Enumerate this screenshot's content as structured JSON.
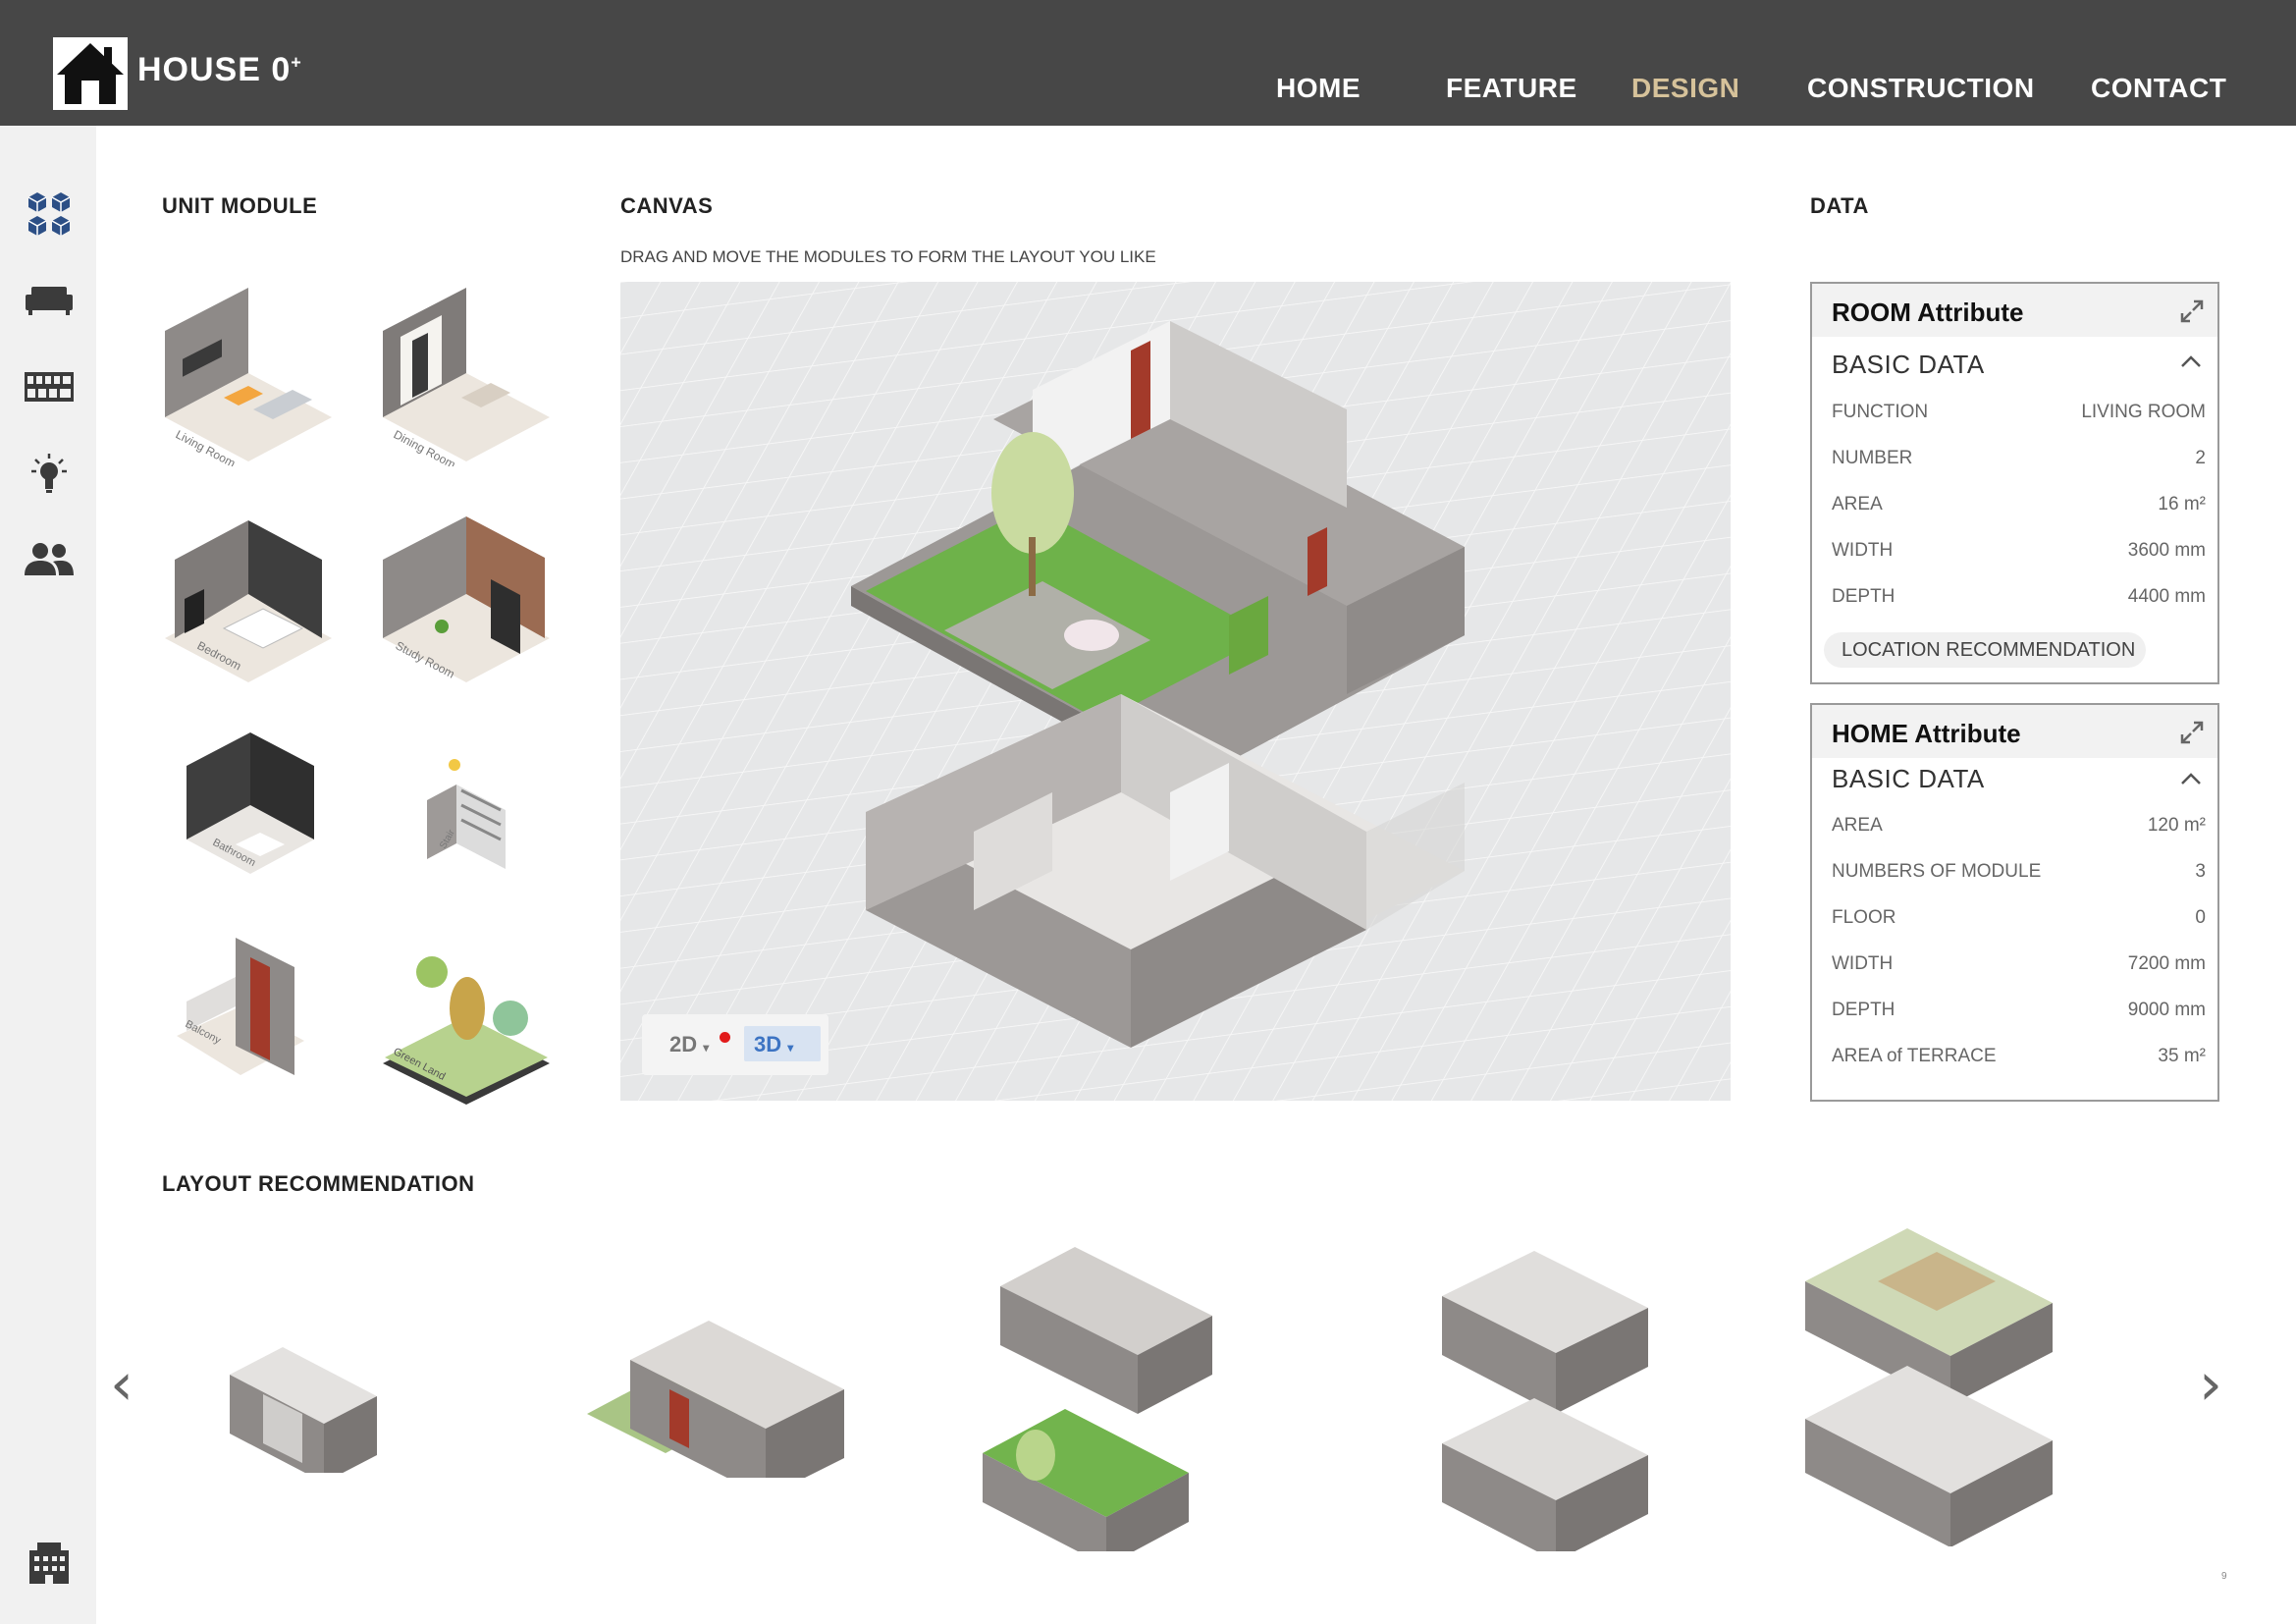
{
  "header": {
    "brand": "HOUSE 0",
    "brand_sup": "+",
    "nav": [
      {
        "label": "HOME",
        "active": false
      },
      {
        "label": "FEATURE",
        "active": false
      },
      {
        "label": "DESIGN",
        "active": true
      },
      {
        "label": "CONSTRUCTION",
        "active": false
      },
      {
        "label": "CONTACT",
        "active": false
      }
    ]
  },
  "sidebar": {
    "icons": [
      "modules-icon",
      "sofa-icon",
      "kitchen-icon",
      "lightbulb-icon",
      "people-icon",
      "building-icon"
    ]
  },
  "unit_module": {
    "title": "UNIT MODULE",
    "modules": [
      {
        "label": "Living Room"
      },
      {
        "label": "Dining Room"
      },
      {
        "label": "Bedroom"
      },
      {
        "label": "Study Room"
      },
      {
        "label": "Bathroom"
      },
      {
        "label": "Stair"
      },
      {
        "label": "Balcony"
      },
      {
        "label": "Green Land"
      }
    ]
  },
  "canvas": {
    "title": "CANVAS",
    "hint": "DRAG AND MOVE THE MODULES TO FORM THE LAYOUT YOU LIKE",
    "toggle_2d": "2D",
    "toggle_3d": "3D"
  },
  "data": {
    "title": "DATA",
    "room": {
      "title": "ROOM Attribute",
      "section": "BASIC DATA",
      "rows": [
        {
          "k": "FUNCTION",
          "v": "LIVING ROOM"
        },
        {
          "k": "NUMBER",
          "v": "2"
        },
        {
          "k": "AREA",
          "v": "16  m²"
        },
        {
          "k": "WIDTH",
          "v": "3600  mm"
        },
        {
          "k": "DEPTH",
          "v": "4400  mm"
        }
      ],
      "button": "LOCATION RECOMMENDATION"
    },
    "home": {
      "title": "HOME Attribute",
      "section": "BASIC DATA",
      "rows": [
        {
          "k": "AREA",
          "v": "120  m²"
        },
        {
          "k": "NUMBERS OF MODULE",
          "v": "3"
        },
        {
          "k": "FLOOR",
          "v": "0"
        },
        {
          "k": "WIDTH",
          "v": "7200  mm"
        },
        {
          "k": "DEPTH",
          "v": "9000  mm"
        },
        {
          "k": "AREA of TERRACE",
          "v": "35  m²"
        }
      ]
    }
  },
  "layout_rec": {
    "title": "LAYOUT RECOMMENDATION",
    "prev": "‹",
    "next": "›"
  },
  "page_number": "9",
  "colors": {
    "topbar": "#474747",
    "accent": "#d6c29a",
    "active_tab": "#3d74c3"
  }
}
